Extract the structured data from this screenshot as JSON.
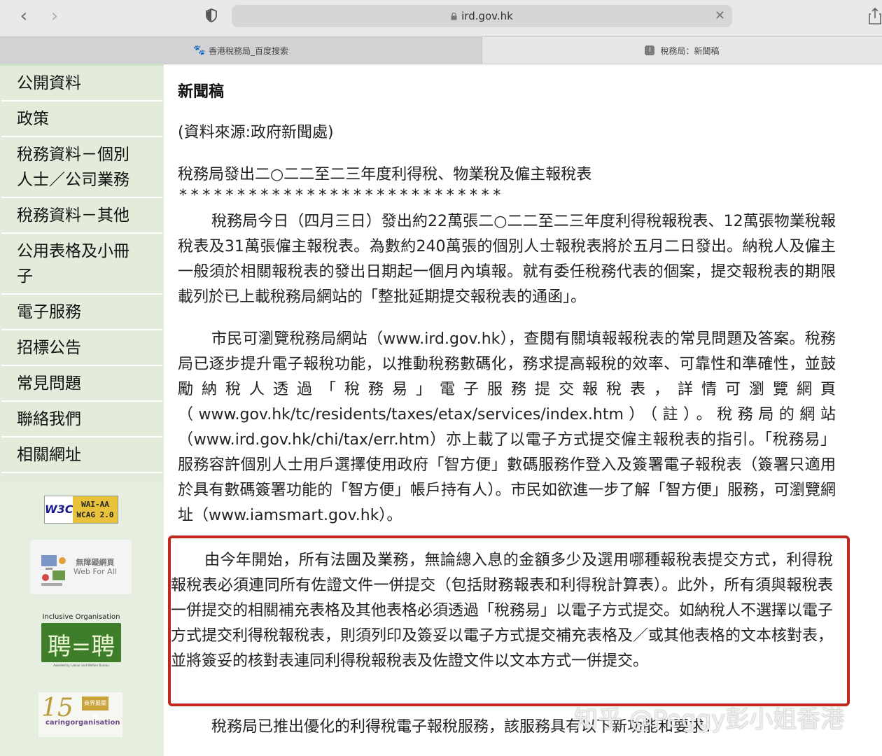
{
  "browser": {
    "url": "ird.gov.hk",
    "tabs": [
      {
        "label": "香港稅務局_百度搜索",
        "active": false
      },
      {
        "label": "稅務局：新聞稿",
        "active": true
      }
    ]
  },
  "sidebar": {
    "items": [
      {
        "label": "公開資料"
      },
      {
        "label": "政策"
      },
      {
        "label": "稅務資料－個別人士／公司業務"
      },
      {
        "label": "稅務資料－其他"
      },
      {
        "label": "公用表格及小冊子"
      },
      {
        "label": "電子服務"
      },
      {
        "label": "招標公告"
      },
      {
        "label": "常見問題"
      },
      {
        "label": "聯絡我們"
      },
      {
        "label": "相關網址"
      }
    ],
    "badges": {
      "w3c_left": "W3C",
      "w3c_right_1": "WAI-AA",
      "w3c_right_2": "WCAG 2.0",
      "webforall_1": "無障礙網頁",
      "webforall_2": "Web For All",
      "inclusive_title": "Inclusive Organisation",
      "inclusive_glyph": "聘=聘",
      "inclusive_foot": "Awarded by Labour and Welfare Bureau",
      "caring_number": "15",
      "caring_plus": "商界展關懷",
      "caring_text": "caringorganisation"
    }
  },
  "main": {
    "title": "新聞稿",
    "source": "(資料來源:政府新聞處)",
    "headline": "稅務局發出二○二二至二三年度利得稅、物業稅及僱主報稅表",
    "stars": "****************************",
    "para1": "稅務局今日（四月三日）發出約22萬張二○二二至二三年度利得稅報稅表、12萬張物業稅報稅表及31萬張僱主報稅表。為數約240萬張的個別人士報稅表將於五月二日發出。納稅人及僱主一般須於相關報稅表的發出日期起一個月內填報。就有委任稅務代表的個案，提交報稅表的期限載列於已上載稅務局網站的「整批延期提交報稅表的通函」。",
    "para2": "市民可瀏覽稅務局網站（www.ird.gov.hk），查閱有關填報報稅表的常見問題及答案。稅務局已逐步提升電子報稅功能，以推動稅務數碼化，務求提高報稅的效率、可靠性和準確性，並鼓勵納稅人透過「稅務易」電子服務提交報稅表，詳情可瀏覽網頁（www.gov.hk/tc/residents/taxes/etax/services/index.htm）（註）。稅務局的網站（www.ird.gov.hk/chi/tax/err.htm）亦上載了以電子方式提交僱主報稅表的指引。「稅務易」服務容許個別人士用戶選擇使用政府「智方便」數碼服務作登入及簽署電子報稅表（簽署只適用於具有數碼簽署功能的「智方便」帳戶持有人）。市民如欲進一步了解「智方便」服務，可瀏覽網址（www.iamsmart.gov.hk）。",
    "para3": "由今年開始，所有法團及業務，無論總入息的金額多少及選用哪種報稅表提交方式，利得稅報稅表必須連同所有佐證文件一併提交（包括財務報表和利得稅計算表）。此外，所有須與報稅表一併提交的相關補充表格及其他表格必須透過「稅務易」以電子方式提交。如納稅人不選擇以電子方式提交利得稅報稅表，則須列印及簽妥以電子方式提交補充表格及／或其他表格的文本核對表，並將簽妥的核對表連同利得稅報稅表及佐證文件以文本方式一併提交。",
    "para4": "稅務局已推出優化的利得稅電子報稅服務，該服務具有以下新功能和要求："
  },
  "watermark": "知乎 @Peggy彭小姐香港",
  "colors": {
    "sidebar_bg": "#e3ecda",
    "highlight_border": "#c0281f"
  }
}
